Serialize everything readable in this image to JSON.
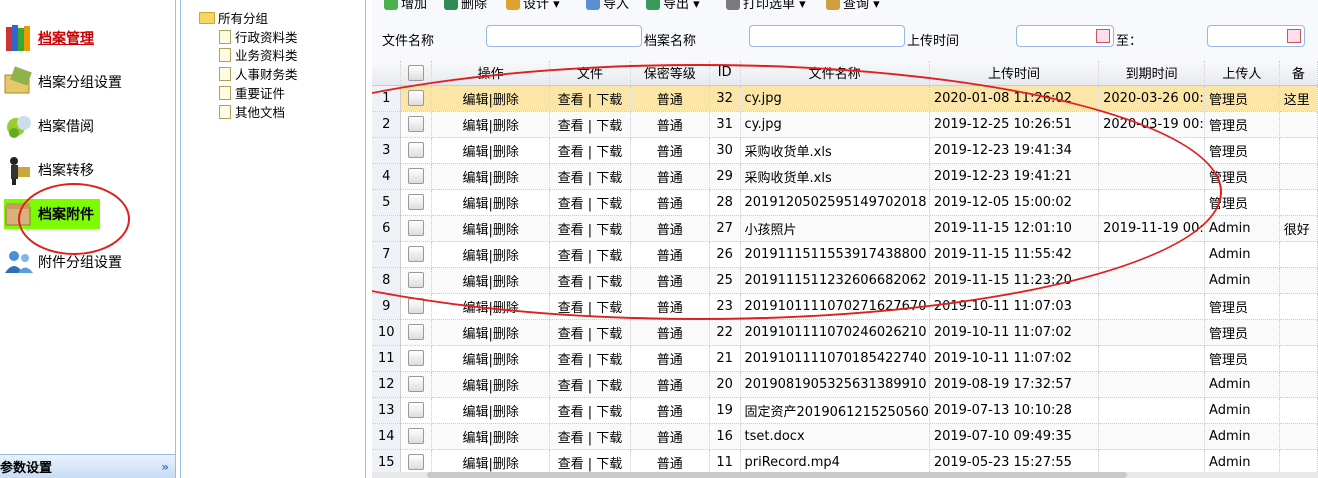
{
  "sidebar": {
    "items": [
      {
        "label": "档案管理",
        "icon": "books-icon",
        "active": true
      },
      {
        "label": "档案分组设置",
        "icon": "folder-group-icon"
      },
      {
        "label": "档案借阅",
        "icon": "borrow-icon"
      },
      {
        "label": "档案转移",
        "icon": "transfer-icon"
      },
      {
        "label": "档案附件",
        "icon": "attachment-box-icon",
        "highlighted": true
      },
      {
        "label": "附件分组设置",
        "icon": "users-group-icon"
      }
    ],
    "footer": {
      "label": "参数设置",
      "chevron": "»"
    }
  },
  "tree": {
    "root": "所有分组",
    "children": [
      "行政资料类",
      "业务资料类",
      "人事财务类",
      "重要证件",
      "其他文档"
    ]
  },
  "toolbar": {
    "buttons": [
      {
        "label": "增加",
        "icon": "add-icon"
      },
      {
        "label": "删除",
        "icon": "delete-icon"
      },
      {
        "label": "设计 ▾",
        "icon": "design-icon"
      },
      {
        "label": "导入",
        "icon": "import-icon"
      },
      {
        "label": "导出 ▾",
        "icon": "export-icon"
      },
      {
        "label": "打印选单 ▾",
        "icon": "print-icon"
      },
      {
        "label": "查询 ▾",
        "icon": "query-icon"
      }
    ]
  },
  "search": {
    "file_name_label": "文件名称",
    "archive_name_label": "档案名称",
    "upload_time_label": "上传时间",
    "to_label": "至："
  },
  "grid": {
    "columns": [
      "操作",
      "文件",
      "保密等级",
      "ID",
      "文件名称",
      "上传时间",
      "到期时间",
      "上传人",
      "备"
    ],
    "rows": [
      {
        "n": "1",
        "op": "编辑|删除",
        "file": "查看 | 下载",
        "level": "普通",
        "id": "32",
        "name": "cy.jpg",
        "upload": "2020-01-08 11:26:02",
        "expire": "2020-03-26 00:",
        "uploader": "管理员",
        "note": "这里"
      },
      {
        "n": "2",
        "op": "编辑|删除",
        "file": "查看 | 下载",
        "level": "普通",
        "id": "31",
        "name": "cy.jpg",
        "upload": "2019-12-25 10:26:51",
        "expire": "2020-03-19 00:",
        "uploader": "管理员",
        "note": ""
      },
      {
        "n": "3",
        "op": "编辑|删除",
        "file": "查看 | 下载",
        "level": "普通",
        "id": "30",
        "name": "采购收货单.xls",
        "upload": "2019-12-23 19:41:34",
        "expire": "",
        "uploader": "管理员",
        "note": ""
      },
      {
        "n": "4",
        "op": "编辑|删除",
        "file": "查看 | 下载",
        "level": "普通",
        "id": "29",
        "name": "采购收货单.xls",
        "upload": "2019-12-23 19:41:21",
        "expire": "",
        "uploader": "管理员",
        "note": ""
      },
      {
        "n": "5",
        "op": "编辑|删除",
        "file": "查看 | 下载",
        "level": "普通",
        "id": "28",
        "name": "2019120502595149702018",
        "upload": "2019-12-05 15:00:02",
        "expire": "",
        "uploader": "管理员",
        "note": ""
      },
      {
        "n": "6",
        "op": "编辑|删除",
        "file": "查看 | 下载",
        "level": "普通",
        "id": "27",
        "name": "小孩照片",
        "upload": "2019-11-15 12:01:10",
        "expire": "2019-11-19 00:",
        "uploader": "Admin",
        "note": "很好"
      },
      {
        "n": "7",
        "op": "编辑|删除",
        "file": "查看 | 下载",
        "level": "普通",
        "id": "26",
        "name": "2019111511553917438800",
        "upload": "2019-11-15 11:55:42",
        "expire": "",
        "uploader": "Admin",
        "note": ""
      },
      {
        "n": "8",
        "op": "编辑|删除",
        "file": "查看 | 下载",
        "level": "普通",
        "id": "25",
        "name": "2019111511232606682062",
        "upload": "2019-11-15 11:23:20",
        "expire": "",
        "uploader": "Admin",
        "note": ""
      },
      {
        "n": "9",
        "op": "编辑|删除",
        "file": "查看 | 下载",
        "level": "普通",
        "id": "23",
        "name": "2019101111070271627670",
        "upload": "2019-10-11 11:07:03",
        "expire": "",
        "uploader": "管理员",
        "note": ""
      },
      {
        "n": "10",
        "op": "编辑|删除",
        "file": "查看 | 下载",
        "level": "普通",
        "id": "22",
        "name": "2019101111070246026210",
        "upload": "2019-10-11 11:07:02",
        "expire": "",
        "uploader": "管理员",
        "note": ""
      },
      {
        "n": "11",
        "op": "编辑|删除",
        "file": "查看 | 下载",
        "level": "普通",
        "id": "21",
        "name": "2019101111070185422740",
        "upload": "2019-10-11 11:07:02",
        "expire": "",
        "uploader": "管理员",
        "note": ""
      },
      {
        "n": "12",
        "op": "编辑|删除",
        "file": "查看 | 下载",
        "level": "普通",
        "id": "20",
        "name": "2019081905325631389910",
        "upload": "2019-08-19 17:32:57",
        "expire": "",
        "uploader": "Admin",
        "note": ""
      },
      {
        "n": "13",
        "op": "编辑|删除",
        "file": "查看 | 下载",
        "level": "普通",
        "id": "19",
        "name": "固定资产2019061215250560",
        "upload": "2019-07-13 10:10:28",
        "expire": "",
        "uploader": "Admin",
        "note": ""
      },
      {
        "n": "14",
        "op": "编辑|删除",
        "file": "查看 | 下载",
        "level": "普通",
        "id": "16",
        "name": "tset.docx",
        "upload": "2019-07-10 09:49:35",
        "expire": "",
        "uploader": "Admin",
        "note": ""
      },
      {
        "n": "15",
        "op": "编辑|删除",
        "file": "查看 | 下载",
        "level": "普通",
        "id": "11",
        "name": "priRecord.mp4",
        "upload": "2019-05-23 15:27:55",
        "expire": "",
        "uploader": "Admin",
        "note": ""
      }
    ]
  },
  "colors": {
    "accent_border": "#95b8e7",
    "selected_row": "#fbe6a8",
    "highlight": "#7cfc00",
    "annotation": "#e02020",
    "active_text": "#cc0000"
  }
}
